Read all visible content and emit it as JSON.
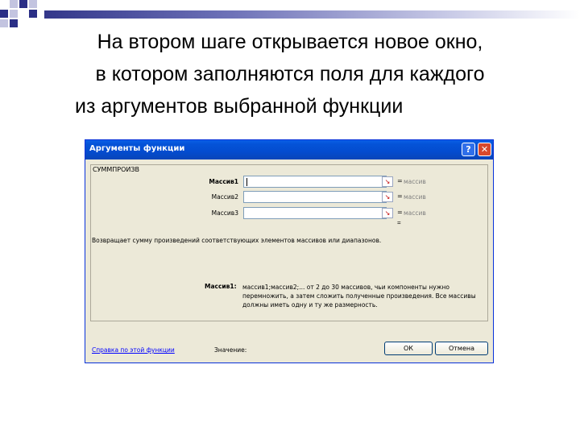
{
  "slide": {
    "line1": "На втором шаге открывается новое окно,",
    "line2": "в котором заполняются поля для каждого",
    "line3": "из аргументов выбранной функции"
  },
  "dialog": {
    "title": "Аргументы функции",
    "help_button": "?",
    "close_button": "✕",
    "function_name": "СУММПРОИЗВ",
    "args": [
      {
        "label": "Массив1",
        "value": "",
        "result": "массив"
      },
      {
        "label": "Массив2",
        "value": "",
        "result": "массив"
      },
      {
        "label": "Массив3",
        "value": "",
        "result": "массив"
      }
    ],
    "equals": "=",
    "result_equals": "=",
    "description": "Возвращает сумму произведений соответствующих элементов массивов или диапазонов.",
    "arg_desc_label": "Массив1:",
    "arg_desc": "массив1;массив2;... от 2 до 30 массивов, чьи компоненты нужно перемножить, а затем сложить полученные произведения. Все массивы должны иметь одну и ту же размерность.",
    "help_link": "Справка по этой функции",
    "value_label": "Значение:",
    "ok_label": "ОК",
    "cancel_label": "Отмена"
  },
  "colors": {
    "accent_dark": "#2b2f86",
    "accent_light": "#c3c4e0",
    "titlebar": "#0453d8"
  }
}
